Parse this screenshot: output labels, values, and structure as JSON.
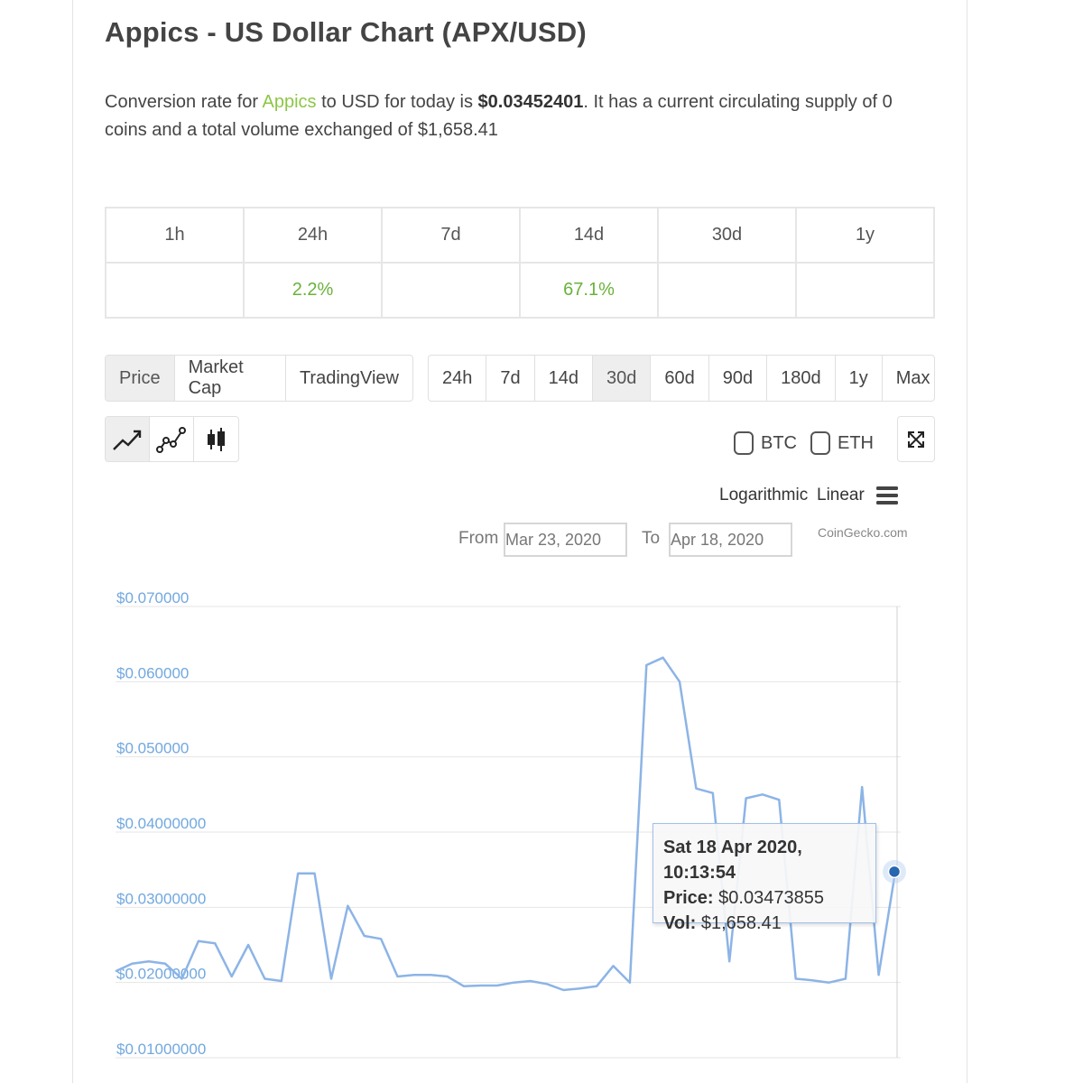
{
  "header": {
    "title": "Appics - US Dollar Chart (APX/USD)"
  },
  "description": {
    "part1": "Conversion rate for ",
    "link": "Appics",
    "part2": " to USD for today is ",
    "rate": "$0.03452401",
    "part3": ". It has a current circulating supply of 0 coins and a total volume exchanged of $1,658.41"
  },
  "performance": {
    "headers": [
      "1h",
      "24h",
      "7d",
      "14d",
      "30d",
      "1y"
    ],
    "values": [
      "",
      "2.2%",
      "",
      "67.1%",
      "",
      ""
    ]
  },
  "chart_tabs": {
    "items": [
      "Price",
      "Market Cap",
      "TradingView"
    ],
    "active": "Price"
  },
  "period_tabs": {
    "items": [
      "24h",
      "7d",
      "14d",
      "30d",
      "60d",
      "90d",
      "180d",
      "1y",
      "Max"
    ],
    "active": "30d"
  },
  "chart_types": {
    "items": [
      "line-chart-icon",
      "scatter-line-icon",
      "candlestick-icon"
    ],
    "active": "line-chart-icon"
  },
  "compare": {
    "btc_label": "BTC",
    "eth_label": "ETH"
  },
  "scale": {
    "logarithmic": "Logarithmic",
    "linear": "Linear"
  },
  "range": {
    "from_label": "From",
    "from_value": "Mar 23, 2020",
    "to_label": "To",
    "to_value": "Apr 18, 2020"
  },
  "credit": "CoinGecko.com",
  "tooltip": {
    "date": "Sat 18 Apr 2020, 10:13:54",
    "price_label": "Price:",
    "price_value": "$0.03473855",
    "vol_label": "Vol:",
    "vol_value": "$1,658.41"
  },
  "colors": {
    "line": "#8cb4e6",
    "marker": "#2766b0",
    "axis_label": "#72a8df",
    "positive": "#6ab23b",
    "brand": "#8dc647"
  },
  "chart_data": {
    "type": "line",
    "y_tick_labels": [
      "$0.070000",
      "$0.060000",
      "$0.050000",
      "$0.04000000",
      "$0.03000000",
      "$0.02000000",
      "$0.01000000"
    ],
    "y_ticks": [
      0.07,
      0.06,
      0.05,
      0.04,
      0.03,
      0.02,
      0.01
    ],
    "ylim": [
      0.01,
      0.07
    ],
    "xlim": [
      "2020-03-23",
      "2020-04-18"
    ],
    "grid": true,
    "series": [
      {
        "x": [
          "2020-03-23",
          "2020-03-23",
          "2020-03-24",
          "2020-03-24",
          "2020-03-25",
          "2020-03-25",
          "2020-03-26",
          "2020-03-26",
          "2020-03-27",
          "2020-03-27",
          "2020-03-27",
          "2020-03-28",
          "2020-03-28",
          "2020-03-29",
          "2020-03-29",
          "2020-03-30",
          "2020-03-30",
          "2020-03-31",
          "2020-03-31",
          "2020-04-01",
          "2020-04-02",
          "2020-04-02",
          "2020-04-03",
          "2020-04-04",
          "2020-04-05",
          "2020-04-06",
          "2020-04-06",
          "2020-04-07",
          "2020-04-07",
          "2020-04-08",
          "2020-04-09",
          "2020-04-09",
          "2020-04-10",
          "2020-04-10",
          "2020-04-11",
          "2020-04-11",
          "2020-04-12",
          "2020-04-13",
          "2020-04-13",
          "2020-04-14",
          "2020-04-14",
          "2020-04-15",
          "2020-04-15",
          "2020-04-16",
          "2020-04-17",
          "2020-04-17",
          "2020-04-18",
          "2020-04-18"
        ],
        "y": [
          0.0215,
          0.0225,
          0.0228,
          0.0225,
          0.0205,
          0.0255,
          0.0252,
          0.0208,
          0.025,
          0.0205,
          0.0202,
          0.0345,
          0.0345,
          0.0205,
          0.0302,
          0.0262,
          0.0258,
          0.0208,
          0.021,
          0.021,
          0.0208,
          0.0195,
          0.0196,
          0.0196,
          0.02,
          0.0202,
          0.0198,
          0.019,
          0.0192,
          0.0195,
          0.0222,
          0.02,
          0.0622,
          0.0632,
          0.06,
          0.0458,
          0.0452,
          0.0228,
          0.0445,
          0.045,
          0.0443,
          0.0205,
          0.0203,
          0.02,
          0.0205,
          0.046,
          0.021,
          0.03473855
        ]
      }
    ]
  }
}
